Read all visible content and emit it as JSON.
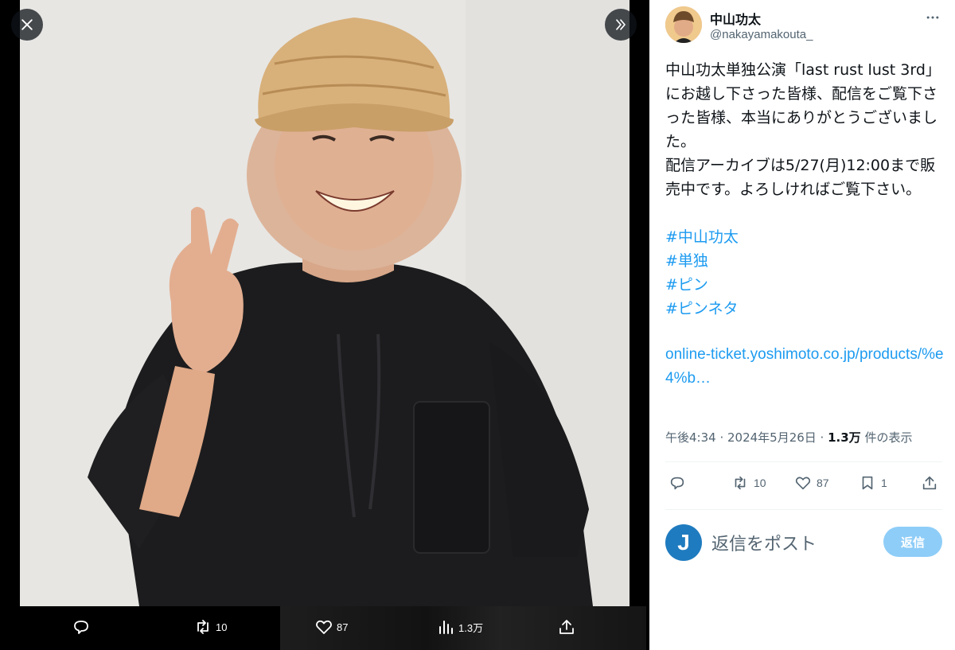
{
  "viewer": {
    "close_icon": "close-icon",
    "expand_icon": "chevron-double-right-icon",
    "bar": {
      "reply_count": "",
      "retweet_count": "10",
      "like_count": "87",
      "views_count": "1.3万"
    }
  },
  "tweet": {
    "author_name": "中山功太",
    "author_handle": "@nakayamakouta_",
    "text": "中山功太単独公演「last rust lust 3rd」にお越し下さった皆様、配信をご覧下さった皆様、本当にありがとうございました。\n配信アーカイブは5/27(月)12:00まで販売中です。よろしければご覧下さい。",
    "hashtags": [
      "#中山功太",
      "#単独",
      "#ピン",
      "#ピンネタ"
    ],
    "link": "online-ticket.yoshimoto.co.jp/products/%e4%b…",
    "time": "午後4:34 · 2024年5月26日 · ",
    "views_value": "1.3万",
    "views_label": " 件の表示",
    "retweet_count": "10",
    "like_count": "87",
    "bookmark_count": "1"
  },
  "reply": {
    "avatar_letter": "J",
    "placeholder": "返信をポスト",
    "button_label": "返信"
  },
  "colors": {
    "accent": "#1d9bf0",
    "reply_button": "#8ecdf8",
    "secondary_text": "#536471"
  }
}
